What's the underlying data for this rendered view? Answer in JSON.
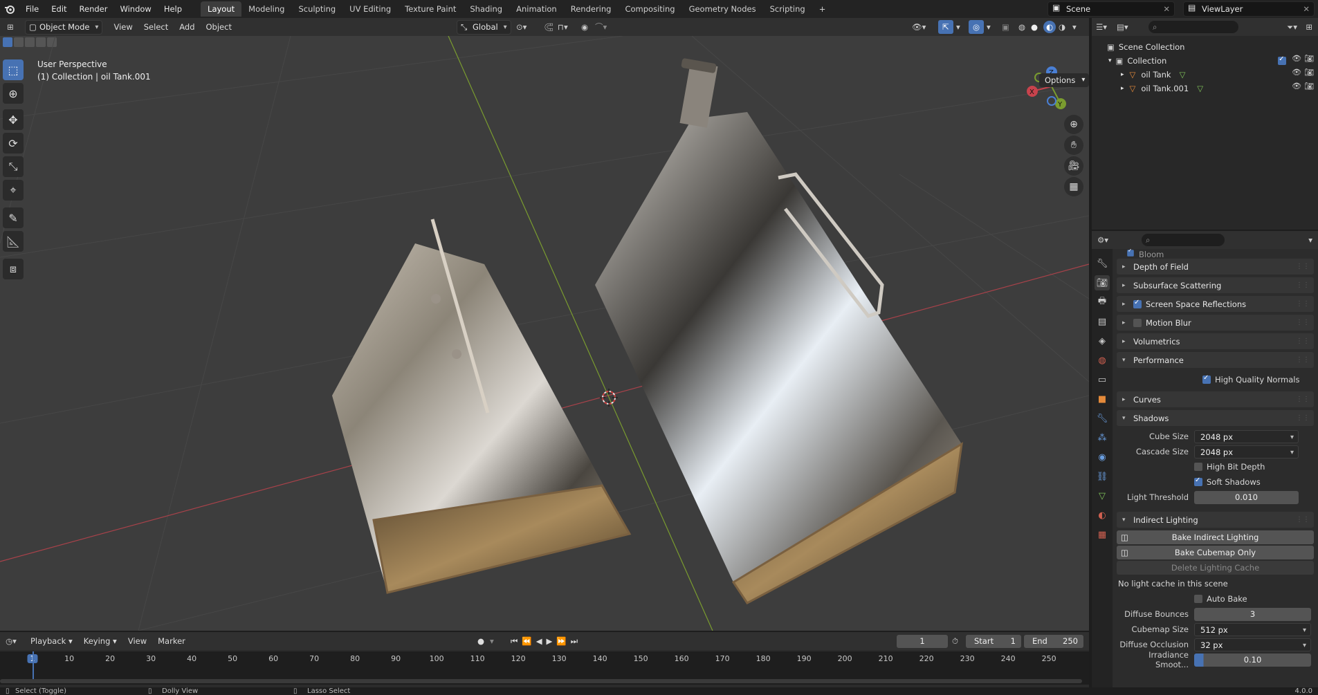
{
  "menu": {
    "items": [
      "File",
      "Edit",
      "Render",
      "Window",
      "Help"
    ]
  },
  "workspaces": {
    "tabs": [
      "Layout",
      "Modeling",
      "Sculpting",
      "UV Editing",
      "Texture Paint",
      "Shading",
      "Animation",
      "Rendering",
      "Compositing",
      "Geometry Nodes",
      "Scripting"
    ],
    "active": "Layout",
    "add": "+"
  },
  "scene": {
    "name": "Scene",
    "view_layer": "ViewLayer"
  },
  "viewport_header": {
    "mode": "Object Mode",
    "menus": [
      "View",
      "Select",
      "Add",
      "Object"
    ],
    "orientation": "Global",
    "options": "Options"
  },
  "viewport": {
    "perspective": "User Perspective",
    "collection_info": "(1) Collection | oil Tank.001",
    "gizmo": {
      "x": "X",
      "y": "Y",
      "z": "Z"
    }
  },
  "outliner": {
    "root": "Scene Collection",
    "collection": "Collection",
    "objects": [
      "oil Tank",
      "oil Tank.001"
    ]
  },
  "properties": {
    "top_partial": "Bloom",
    "panels": [
      {
        "label": "Depth of Field",
        "checkbox": null
      },
      {
        "label": "Subsurface Scattering",
        "checkbox": null
      },
      {
        "label": "Screen Space Reflections",
        "checkbox": true
      },
      {
        "label": "Motion Blur",
        "checkbox": false
      },
      {
        "label": "Volumetrics",
        "checkbox": null
      },
      {
        "label": "Performance",
        "checkbox": null
      }
    ],
    "performance": {
      "high_quality_normals": "High Quality Normals"
    },
    "curves": "Curves",
    "shadows": {
      "title": "Shadows",
      "cube_size_label": "Cube Size",
      "cube_size": "2048 px",
      "cascade_size_label": "Cascade Size",
      "cascade_size": "2048 px",
      "high_bit_depth": "High Bit Depth",
      "soft_shadows": "Soft Shadows",
      "light_threshold_label": "Light Threshold",
      "light_threshold": "0.010"
    },
    "indirect": {
      "title": "Indirect Lighting",
      "bake_indirect": "Bake Indirect Lighting",
      "bake_cubemap": "Bake Cubemap Only",
      "delete_cache": "Delete Lighting Cache",
      "no_cache": "No light cache in this scene",
      "auto_bake": "Auto Bake",
      "diffuse_bounces_label": "Diffuse Bounces",
      "diffuse_bounces": "3",
      "cubemap_size_label": "Cubemap Size",
      "cubemap_size": "512 px",
      "diffuse_occlusion_label": "Diffuse Occlusion",
      "diffuse_occlusion": "32 px",
      "irradiance_label": "Irradiance Smoot...",
      "irradiance": "0.10"
    }
  },
  "timeline": {
    "menus": [
      "Playback",
      "Keying",
      "View",
      "Marker"
    ],
    "current_frame": "1",
    "start_label": "Start",
    "start": "1",
    "end_label": "End",
    "end": "250",
    "ticks": [
      "1",
      "10",
      "20",
      "30",
      "40",
      "50",
      "60",
      "70",
      "80",
      "90",
      "100",
      "110",
      "120",
      "130",
      "140",
      "150",
      "160",
      "170",
      "180",
      "190",
      "200",
      "210",
      "220",
      "230",
      "240",
      "250"
    ]
  },
  "status": {
    "select": "Select (Toggle)",
    "dolly": "Dolly View",
    "lasso": "Lasso Select",
    "version": "4.0.0"
  },
  "colors": {
    "accent": "#4772b3",
    "x_axis": "#c8434d",
    "y_axis": "#7a9c2f",
    "z_axis": "#4a7fd4",
    "object_orange": "#e48a3a"
  }
}
